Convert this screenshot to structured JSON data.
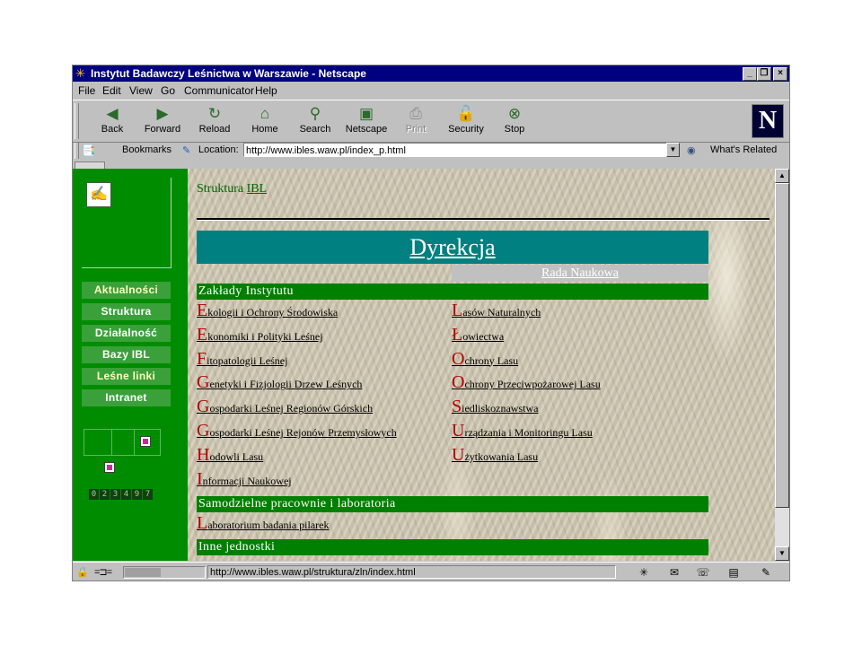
{
  "window": {
    "title": "Instytut Badawczy Leśnictwa w Warszawie - Netscape",
    "minimize": "_",
    "maximize": "❐",
    "close": "×"
  },
  "menu": [
    "File",
    "Edit",
    "View",
    "Go",
    "Communicator",
    "Help"
  ],
  "toolbar": [
    {
      "label": "Back",
      "icon": "back-arrow-icon",
      "glyph": "◀",
      "enabled": true
    },
    {
      "label": "Forward",
      "icon": "forward-arrow-icon",
      "glyph": "▶",
      "enabled": true
    },
    {
      "label": "Reload",
      "icon": "reload-icon",
      "glyph": "↻",
      "enabled": true
    },
    {
      "label": "Home",
      "icon": "home-icon",
      "glyph": "⌂",
      "enabled": true
    },
    {
      "label": "Search",
      "icon": "search-icon",
      "glyph": "⚲",
      "enabled": true
    },
    {
      "label": "Netscape",
      "icon": "netscape-my-icon",
      "glyph": "▣",
      "enabled": true
    },
    {
      "label": "Print",
      "icon": "print-icon",
      "glyph": "⎙",
      "enabled": false
    },
    {
      "label": "Security",
      "icon": "security-lock-icon",
      "glyph": "🔓",
      "enabled": true
    },
    {
      "label": "Stop",
      "icon": "stop-icon",
      "glyph": "⊗",
      "enabled": true
    }
  ],
  "brand_logo": "N",
  "location_bar": {
    "bookmarks_label": "Bookmarks",
    "location_label": "Location:",
    "url": "http://www.ibles.waw.pl/index_p.html",
    "whats_related": "What's Related"
  },
  "sidebar": {
    "buttons": [
      {
        "label": "Aktualności",
        "highlight": true
      },
      {
        "label": "Struktura",
        "highlight": false
      },
      {
        "label": "Działalność",
        "highlight": false
      },
      {
        "label": "Bazy IBL",
        "highlight": false
      },
      {
        "label": "Leśne linki",
        "highlight": true
      },
      {
        "label": "Intranet",
        "highlight": false
      }
    ],
    "counter": [
      "0",
      "2",
      "3",
      "4",
      "9",
      "7"
    ]
  },
  "content": {
    "breadcrumb_prefix": "Struktura",
    "breadcrumb_link": "IBL",
    "heading": "Dyrekcja",
    "rada": "Rada Naukowa",
    "section_institute": "Zakłady Instytutu",
    "left_links": [
      {
        "cap": "E",
        "rest": "kologii i Ochrony Środowiska"
      },
      {
        "cap": "E",
        "rest": "konomiki i Polityki Leśnej"
      },
      {
        "cap": "F",
        "rest": "itopatologii Leśnej"
      },
      {
        "cap": "G",
        "rest": "enetyki i Fizjologii Drzew Leśnych"
      },
      {
        "cap": "G",
        "rest": "ospodarki Leśnej Regionów Górskich"
      },
      {
        "cap": "G",
        "rest": "ospodarki Leśnej Rejonów Przemysłowych"
      },
      {
        "cap": "H",
        "rest": "odowli Lasu"
      },
      {
        "cap": "I",
        "rest": "nformacji Naukowej"
      }
    ],
    "right_links": [
      {
        "cap": "L",
        "rest": "asów Naturalnych"
      },
      {
        "cap": "Ł",
        "rest": "owiectwa"
      },
      {
        "cap": "O",
        "rest": "chrony Lasu"
      },
      {
        "cap": "O",
        "rest": "chrony Przeciwpożarowej Lasu"
      },
      {
        "cap": "S",
        "rest": "iedliskoznawstwa"
      },
      {
        "cap": "U",
        "rest": "rządzania i Monitoringu Lasu"
      },
      {
        "cap": "U",
        "rest": "żytkowania Lasu"
      }
    ],
    "section_labs": "Samodzielne pracownie i laboratoria",
    "lab_link": {
      "cap": "L",
      "rest": "aboratorium badania pilarek"
    },
    "section_other": "Inne jednostki"
  },
  "status": {
    "text": "http://www.ibles.waw.pl/struktura/zln/index.html",
    "progress": 0.45
  }
}
